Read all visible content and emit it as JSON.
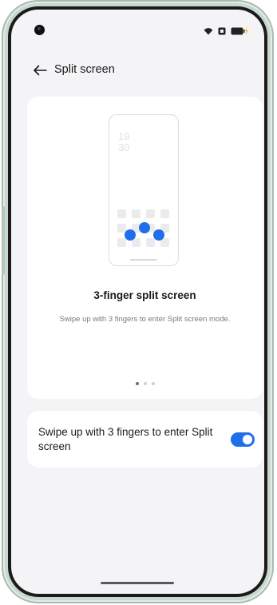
{
  "header": {
    "title": "Split screen",
    "back_icon": "arrow-left-icon"
  },
  "status_bar": {
    "icons": [
      "camera-hole",
      "wifi-icon",
      "sim-icon",
      "battery-charging-icon"
    ]
  },
  "illustration": {
    "clock_hour": "19",
    "clock_minute": "30",
    "heading": "3-finger split screen",
    "description": "Swipe up with 3 fingers to enter Split screen mode.",
    "pages": [
      {
        "active": true
      },
      {
        "active": false
      },
      {
        "active": false
      }
    ]
  },
  "setting": {
    "label": "Swipe up with 3 fingers to enter Split screen",
    "enabled": true
  },
  "colors": {
    "accent": "#1f6feb",
    "background": "#f4f4f6",
    "card": "#ffffff",
    "frame": "#c9d8cf"
  }
}
